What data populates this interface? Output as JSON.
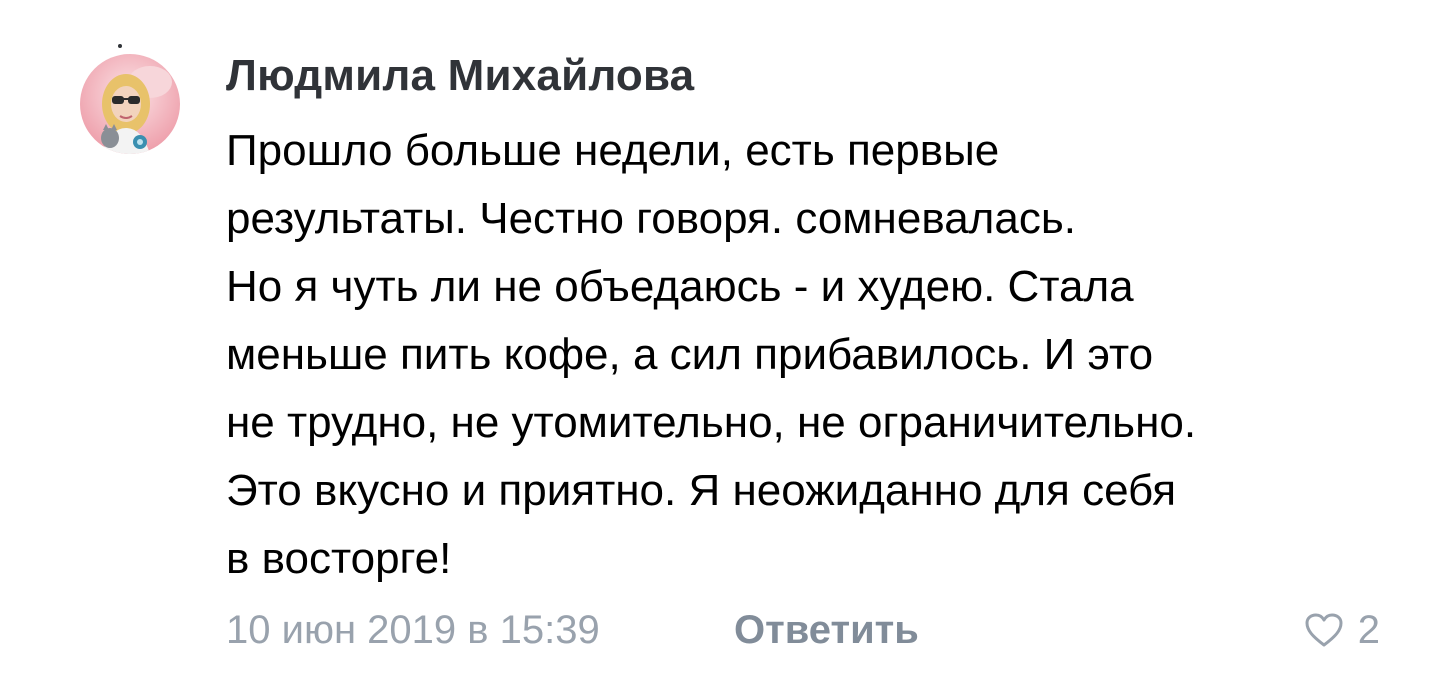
{
  "comment": {
    "author": "Людмила Михайлова",
    "text_lines": [
      "Прошло больше недели, есть первые",
      "результаты. Честно говоря. сомневалась.",
      "Но я чуть ли не объедаюсь - и худею. Стала",
      "меньше пить кофе, а сил прибавилось. И это",
      "не трудно, не утомительно, не ограничительно.",
      "Это вкусно и приятно. Я неожиданно для себя",
      "в восторге!"
    ],
    "date": "10 июн 2019 в 15:39",
    "reply_label": "Ответить",
    "like_icon": "heart-outline-icon",
    "like_count": "2"
  },
  "colors": {
    "author": "#303338",
    "text": "#000000",
    "meta": "#99a2ad",
    "reply": "#818c99",
    "avatar_bg": "#f4c9cf"
  }
}
